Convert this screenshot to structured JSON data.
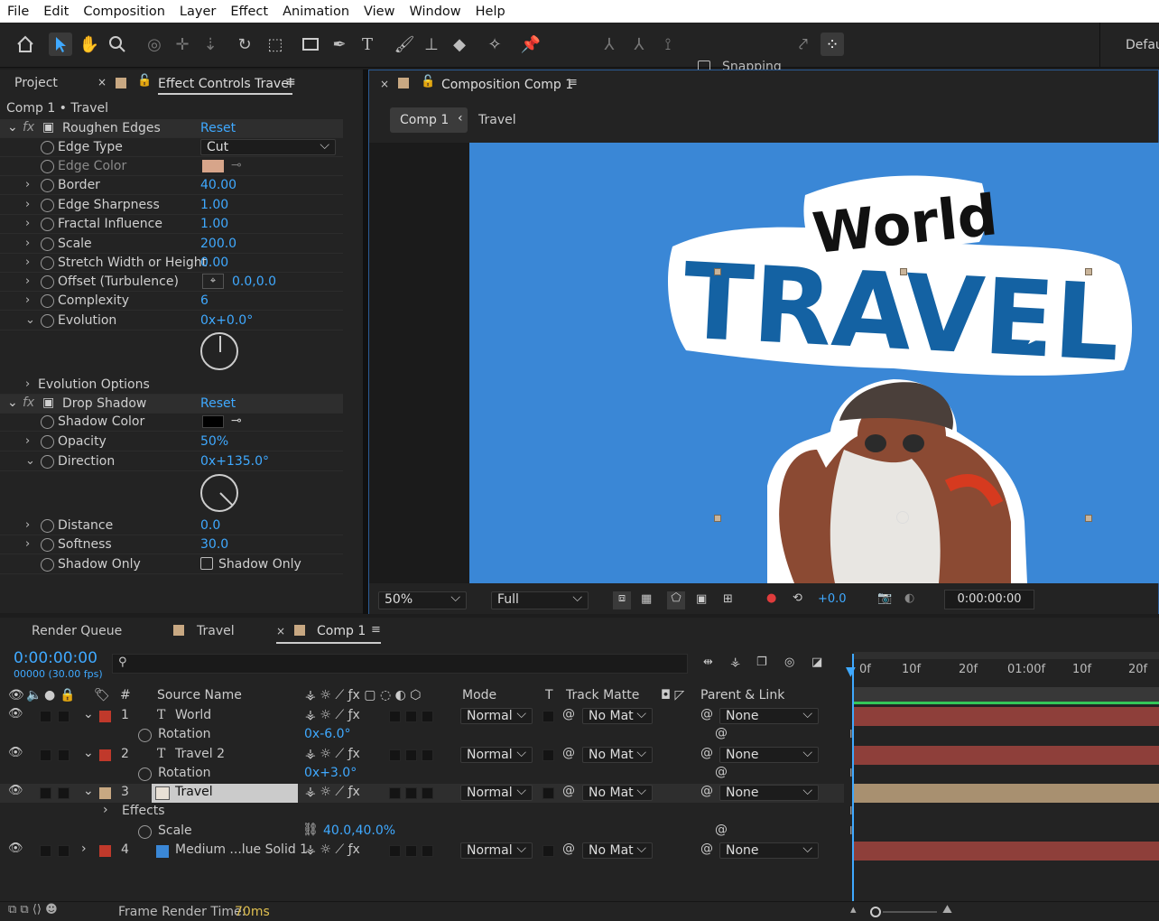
{
  "menu": [
    "File",
    "Edit",
    "Composition",
    "Layer",
    "Effect",
    "Animation",
    "View",
    "Window",
    "Help"
  ],
  "toolbar": {
    "snapping": "Snapping",
    "workspace": "Defau"
  },
  "left_panel": {
    "tab_project": "Project",
    "tab_effect": "Effect Controls Travel",
    "breadcrumb": "Comp 1 • Travel",
    "fx1": {
      "name": "Roughen Edges",
      "reset": "Reset"
    },
    "props1": [
      {
        "label": "Edge Type",
        "value": "Cut"
      },
      {
        "label": "Edge Color",
        "value": ""
      },
      {
        "label": "Border",
        "value": "40.00"
      },
      {
        "label": "Edge Sharpness",
        "value": "1.00"
      },
      {
        "label": "Fractal Influence",
        "value": "1.00"
      },
      {
        "label": "Scale",
        "value": "200.0"
      },
      {
        "label": "Stretch Width or Height",
        "value": "0.00"
      },
      {
        "label": "Offset (Turbulence)",
        "value": "0.0,0.0"
      },
      {
        "label": "Complexity",
        "value": "6"
      },
      {
        "label": "Evolution",
        "value": "0x+0.0°"
      },
      {
        "label": "Evolution Options",
        "value": ""
      }
    ],
    "fx2": {
      "name": "Drop Shadow",
      "reset": "Reset"
    },
    "props2": [
      {
        "label": "Shadow Color",
        "value": ""
      },
      {
        "label": "Opacity",
        "value": "50%"
      },
      {
        "label": "Direction",
        "value": "0x+135.0°"
      },
      {
        "label": "Distance",
        "value": "0.0"
      },
      {
        "label": "Softness",
        "value": "30.0"
      },
      {
        "label": "Shadow Only",
        "value": "Shadow Only"
      }
    ],
    "colors": {
      "edge": "#d7a58a",
      "shadow": "#000000"
    }
  },
  "comp": {
    "tab": "Composition Comp 1",
    "crumb1": "Comp 1",
    "crumb2": "Travel",
    "artwork_text1": "World",
    "artwork_text2": "TRAVEL",
    "zoom": "50%",
    "quality": "Full",
    "exposure": "+0.0",
    "timecode": "0:00:00:00",
    "bg": "#3a87d6"
  },
  "timeline": {
    "tab_render": "Render Queue",
    "tab_travel": "Travel",
    "tab_comp": "Comp 1",
    "time": "0:00:00:00",
    "frames": "00000 (30.00 fps)",
    "search_placeholder": "",
    "cols": {
      "num": "#",
      "source": "Source Name",
      "mode": "Mode",
      "t": "T",
      "matte": "Track Matte",
      "parent": "Parent & Link"
    },
    "ruler": [
      "0f",
      "10f",
      "20f",
      "01:00f",
      "10f",
      "20f"
    ],
    "layers": [
      {
        "num": "1",
        "type": "T",
        "name": "World",
        "mode": "Normal",
        "matte": "No Mat",
        "parent": "None",
        "color": "#c0392b",
        "sub": {
          "label": "Rotation",
          "value": "0x-6.0°"
        }
      },
      {
        "num": "2",
        "type": "T",
        "name": "Travel 2",
        "mode": "Normal",
        "matte": "No Mat",
        "parent": "None",
        "color": "#c0392b",
        "sub": {
          "label": "Rotation",
          "value": "0x+3.0°"
        }
      },
      {
        "num": "3",
        "type": "img",
        "name": "Travel",
        "mode": "Normal",
        "matte": "No Mat",
        "parent": "None",
        "color": "#c8a882",
        "sub1": "Effects",
        "sub2": {
          "label": "Scale",
          "value": "40.0,40.0%"
        }
      },
      {
        "num": "4",
        "type": "solid",
        "name": "Medium ...lue Solid 1",
        "mode": "Normal",
        "matte": "No Mat",
        "parent": "None",
        "color": "#c0392b"
      }
    ],
    "status_label": "Frame Render Time:",
    "status_value": "70ms"
  }
}
